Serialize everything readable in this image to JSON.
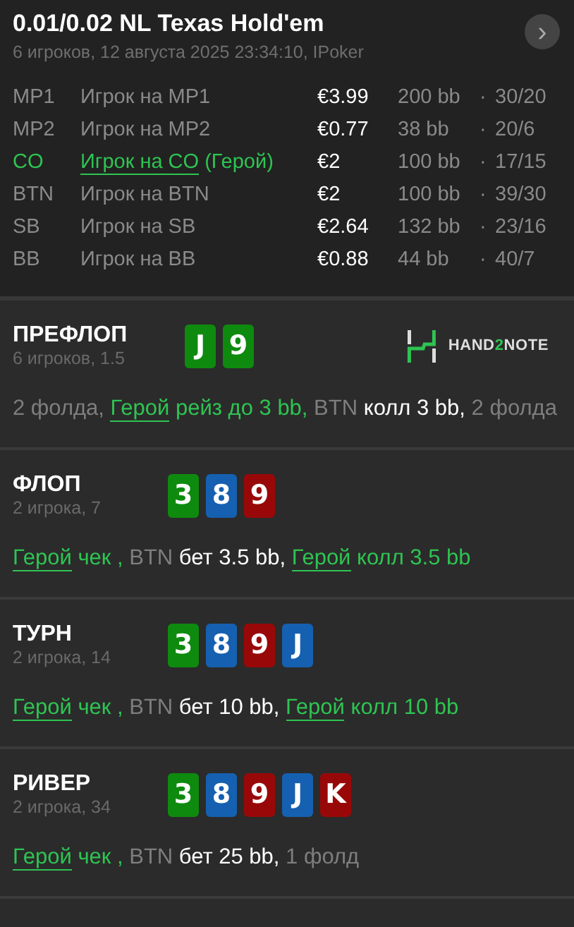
{
  "header": {
    "title": "0.01/0.02 NL Texas Hold'em",
    "subtitle": "6 игроков, 12 августа 2025 23:34:10, IPoker",
    "next_button": "›"
  },
  "players": [
    {
      "position": "MP1",
      "name": "Игрок на MP1",
      "hero": false,
      "stack": "€3.99",
      "bb": "200 bb",
      "separator": "·",
      "stats": "30/20"
    },
    {
      "position": "MP2",
      "name": "Игрок на MP2",
      "hero": false,
      "stack": "€0.77",
      "bb": "38 bb",
      "separator": "·",
      "stats": "20/6"
    },
    {
      "position": "CO",
      "name": "Игрок на CO",
      "hero": true,
      "hero_tag": "(Герой)",
      "stack": "€2",
      "bb": "100 bb",
      "separator": "·",
      "stats": "17/15"
    },
    {
      "position": "BTN",
      "name": "Игрок на BTN",
      "hero": false,
      "stack": "€2",
      "bb": "100 bb",
      "separator": "·",
      "stats": "39/30"
    },
    {
      "position": "SB",
      "name": "Игрок на SB",
      "hero": false,
      "stack": "€2.64",
      "bb": "132 bb",
      "separator": "·",
      "stats": "23/16"
    },
    {
      "position": "BB",
      "name": "Игрок на BB",
      "hero": false,
      "stack": "€0.88",
      "bb": "44 bb",
      "separator": "·",
      "stats": "40/7"
    }
  ],
  "streets": [
    {
      "name": "ПРЕФЛОП",
      "info": "6 игроков, 1.5",
      "logo": [
        {
          "text": "HAND",
          "accent": false
        },
        {
          "text": "2",
          "accent": true
        },
        {
          "text": "NOTE",
          "accent": false
        }
      ],
      "cards": [
        {
          "rank": "J",
          "color": "#0e8a0e"
        },
        {
          "rank": "9",
          "color": "#0e8a0e"
        }
      ],
      "actions": [
        {
          "kind": "muted",
          "text": "2 фолда, "
        },
        {
          "kind": "hero",
          "text": "Герой"
        },
        {
          "kind": "hero-action",
          "text": " рейз до 3 bb,"
        },
        {
          "kind": "muted",
          "text": " BTN "
        },
        {
          "kind": "action",
          "text": "колл 3 bb,"
        },
        {
          "kind": "muted",
          "text": " 2 фолда"
        }
      ]
    },
    {
      "name": "ФЛОП",
      "info": "2 игрока, 7",
      "cards": [
        {
          "rank": "3",
          "color": "#0e8a0e"
        },
        {
          "rank": "8",
          "color": "#1560b0"
        },
        {
          "rank": "9",
          "color": "#990808"
        }
      ],
      "actions": [
        {
          "kind": "hero",
          "text": "Герой"
        },
        {
          "kind": "hero-action",
          "text": " чек ,"
        },
        {
          "kind": "muted",
          "text": " BTN "
        },
        {
          "kind": "action",
          "text": "бет 3.5 bb, "
        },
        {
          "kind": "hero",
          "text": "Герой"
        },
        {
          "kind": "hero-action",
          "text": " колл 3.5 bb"
        }
      ]
    },
    {
      "name": "ТУРН",
      "info": "2 игрока, 14",
      "cards": [
        {
          "rank": "3",
          "color": "#0e8a0e"
        },
        {
          "rank": "8",
          "color": "#1560b0"
        },
        {
          "rank": "9",
          "color": "#990808"
        },
        {
          "rank": "J",
          "color": "#1560b0"
        }
      ],
      "actions": [
        {
          "kind": "hero",
          "text": "Герой"
        },
        {
          "kind": "hero-action",
          "text": " чек ,"
        },
        {
          "kind": "muted",
          "text": " BTN "
        },
        {
          "kind": "action",
          "text": "бет 10 bb, "
        },
        {
          "kind": "hero",
          "text": "Герой"
        },
        {
          "kind": "hero-action",
          "text": " колл 10 bb"
        }
      ]
    },
    {
      "name": "РИВЕР",
      "info": "2 игрока, 34",
      "cards": [
        {
          "rank": "3",
          "color": "#0e8a0e"
        },
        {
          "rank": "8",
          "color": "#1560b0"
        },
        {
          "rank": "9",
          "color": "#990808"
        },
        {
          "rank": "J",
          "color": "#1560b0"
        },
        {
          "rank": "K",
          "color": "#990808"
        }
      ],
      "actions": [
        {
          "kind": "hero",
          "text": "Герой"
        },
        {
          "kind": "hero-action",
          "text": " чек ,"
        },
        {
          "kind": "muted",
          "text": " BTN "
        },
        {
          "kind": "action",
          "text": "бет 25 bb,"
        },
        {
          "kind": "muted",
          "text": " 1 фолд"
        }
      ]
    }
  ]
}
